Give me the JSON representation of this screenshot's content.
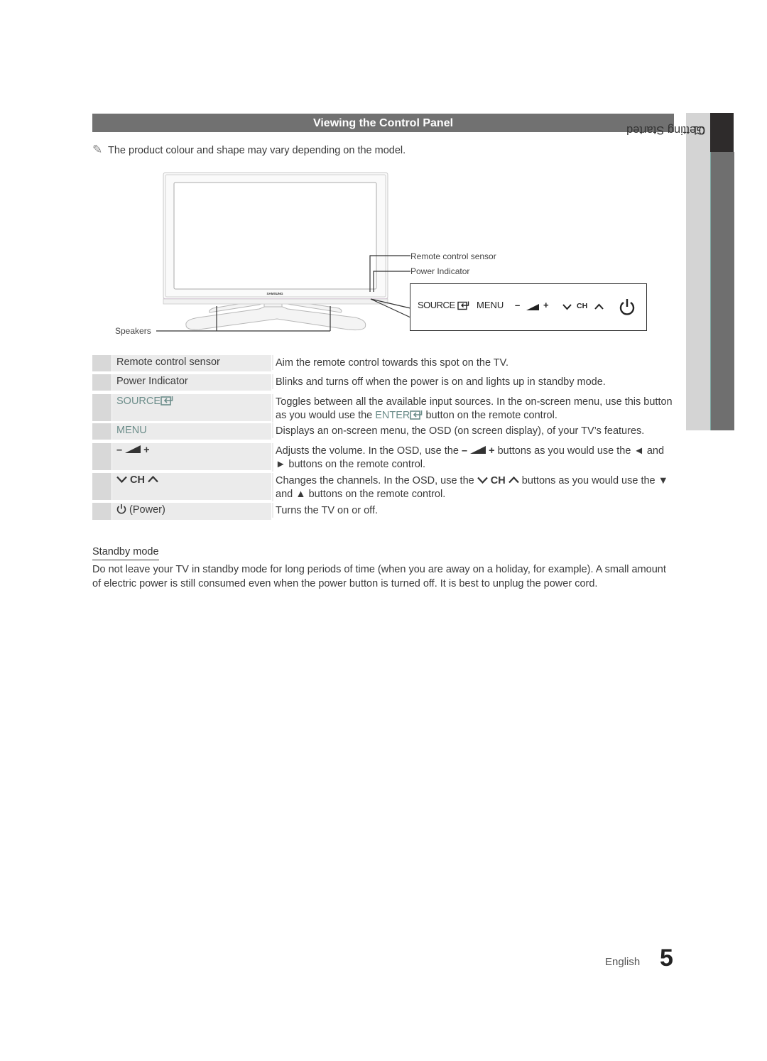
{
  "section": {
    "title": "Viewing the Control Panel",
    "note_icon": "pencil-note-icon",
    "note": "The product colour and shape may vary depending on the model."
  },
  "side_tab": {
    "chapter_number": "01",
    "chapter_title": "Getting Started"
  },
  "diagram": {
    "brand_label": "SAMSUNG",
    "callouts": {
      "remote_sensor": "Remote control sensor",
      "power_indicator": "Power Indicator",
      "speakers": "Speakers"
    },
    "control_panel": {
      "source_label": "SOURCE",
      "source_icon": "enter-icon",
      "menu_label": "MENU",
      "volume_minus": "–",
      "volume_icon": "volume-wedge-icon",
      "volume_plus": "+",
      "ch_down_icon": "chevron-down-icon",
      "ch_label": "CH",
      "ch_up_icon": "chevron-up-icon",
      "power_icon": "power-icon"
    }
  },
  "table": {
    "rows": [
      {
        "label": "Remote control sensor",
        "description": "Aim the remote control towards this spot on the TV."
      },
      {
        "label": "Power Indicator",
        "description": "Blinks and turns off when the power is on and lights up in standby mode."
      },
      {
        "label": "SOURCE",
        "desc_a": "Toggles between all the available input sources. In the on-screen menu, use this button as you would use the ",
        "desc_enter": "ENTER",
        "desc_b": " button on the remote control."
      },
      {
        "label": "MENU",
        "description": "Displays an on-screen menu, the OSD (on screen display), of your TV’s features."
      },
      {
        "label_minus": "–",
        "label_plus": "+",
        "desc_a": "Adjusts the volume. In the OSD, use the ",
        "desc_minus": "–",
        "desc_plus": "+",
        "desc_b": " buttons as you would use the ◄ and ► buttons on the remote control."
      },
      {
        "label_ch": "CH",
        "desc_a": "Changes the channels. In the OSD, use the ",
        "desc_ch": "CH",
        "desc_b": " buttons as you would use the ▼ and ▲ buttons on the remote control."
      },
      {
        "label": "(Power)",
        "description": "Turns the TV on or off."
      }
    ]
  },
  "standby": {
    "title": "Standby mode",
    "body": "Do not leave your TV in standby mode for long periods of time (when you are away on a holiday, for example). A small amount of electric power is still consumed even when the power button is turned off. It is best to unplug the power cord."
  },
  "footer": {
    "language": "English",
    "page_number": "5"
  }
}
